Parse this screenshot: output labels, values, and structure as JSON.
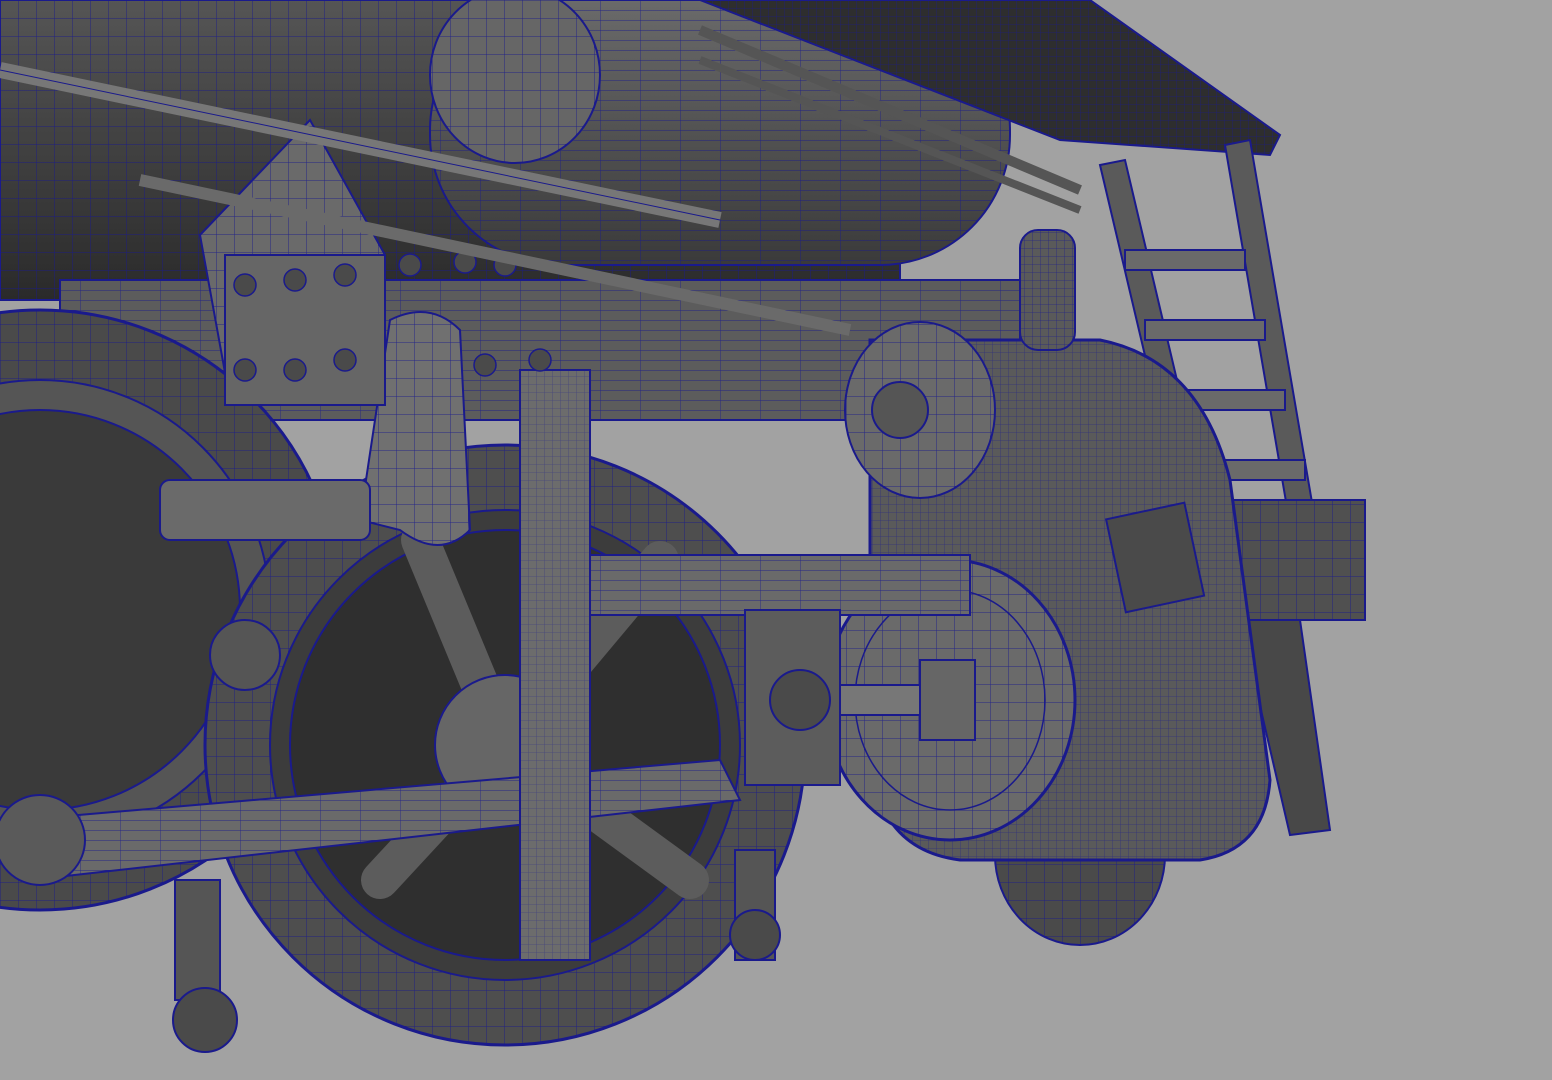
{
  "viewport": {
    "background": "#a2a2a2",
    "shade_dark": "#3a3a3a",
    "shade_mid": "#5a5a5a",
    "shade_light": "#6e6e6e",
    "wire_color": "#1a1a8c"
  }
}
